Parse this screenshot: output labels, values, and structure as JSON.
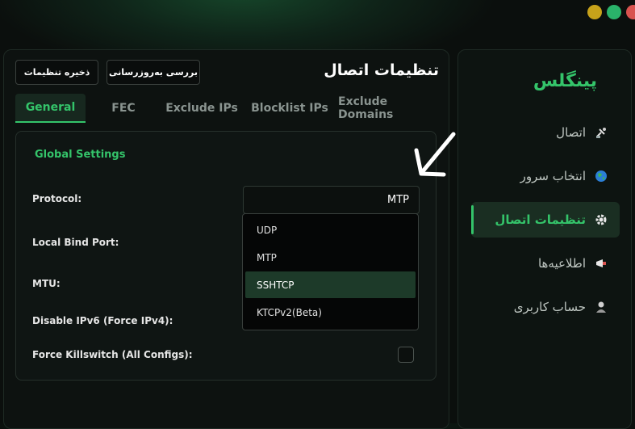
{
  "window_controls": [
    {
      "name": "minimize",
      "color": "#c7a21a"
    },
    {
      "name": "maximize",
      "color": "#2ab36a"
    },
    {
      "name": "close",
      "color": "#d9534f"
    }
  ],
  "sidebar": {
    "brand": "پینگلس",
    "items": [
      {
        "label": "اتصال",
        "icon": "satellite-icon",
        "active": false
      },
      {
        "label": "انتخاب سرور",
        "icon": "globe-icon",
        "active": false
      },
      {
        "label": "تنظیمات اتصال",
        "icon": "gear-icon",
        "active": true
      },
      {
        "label": "اطلاعیه‌ها",
        "icon": "megaphone-icon",
        "active": false
      },
      {
        "label": "حساب کاربری",
        "icon": "user-icon",
        "active": false
      }
    ]
  },
  "header": {
    "title": "تنظیمات اتصال",
    "save_label": "ذخیره تنظیمات",
    "update_label": "بررسی به‌روزرسانی"
  },
  "tabs": [
    {
      "label": "General",
      "active": true
    },
    {
      "label": "FEC",
      "active": false
    },
    {
      "label": "Exclude IPs",
      "active": false
    },
    {
      "label": "Blocklist IPs",
      "active": false
    },
    {
      "label": "Exclude Domains",
      "active": false
    }
  ],
  "global_settings": {
    "title": "Global Settings",
    "protocol_label": "Protocol:",
    "protocol_value": "MTP",
    "local_bind_port_label": "Local Bind Port:",
    "mtu_label": "MTU:",
    "disable_ipv6_label": "Disable IPv6 (Force IPv4):",
    "force_killswitch_label": "Force Killswitch (All Configs):",
    "force_killswitch_checked": false
  },
  "protocol_dropdown": {
    "options": [
      "UDP",
      "MTP",
      "SSHTCP",
      "KTCPv2(Beta)"
    ],
    "highlighted": "SSHTCP"
  },
  "colors": {
    "accent": "#34c46a",
    "background": "#0b0f0d",
    "highlight": "#1d3a29"
  }
}
